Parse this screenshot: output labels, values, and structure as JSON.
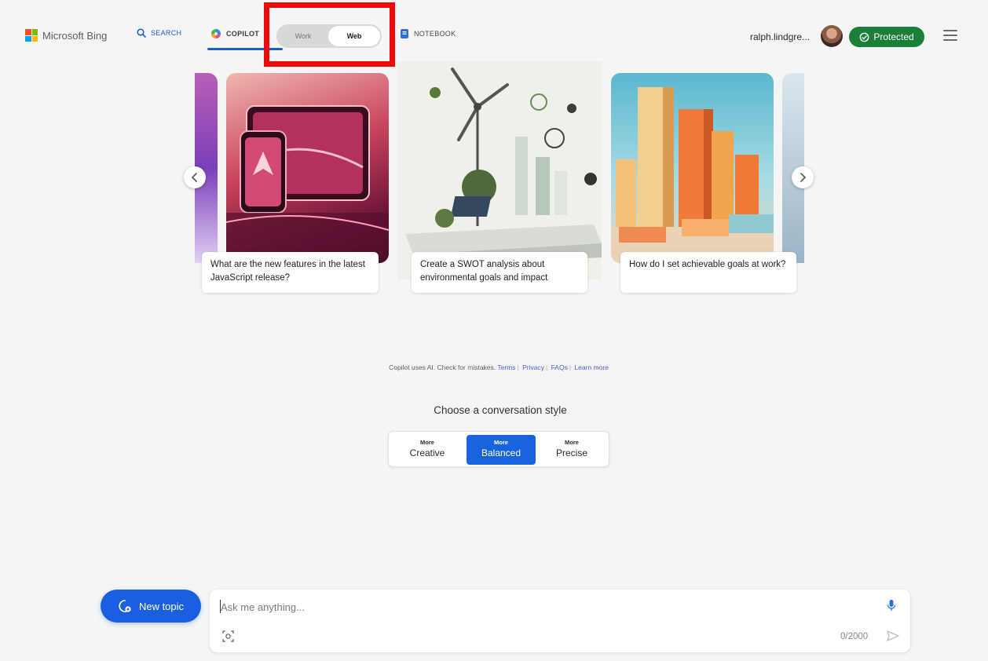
{
  "header": {
    "brand": "Microsoft Bing",
    "nav": {
      "search": "SEARCH",
      "copilot": "COPILOT",
      "notebook": "NOTEBOOK"
    },
    "toggle": {
      "work": "Work",
      "web": "Web",
      "selected": "Web"
    },
    "user_name": "ralph.lindgre...",
    "protected_label": "Protected"
  },
  "carousel": {
    "cards": [
      {
        "caption": "What are the new features in the latest JavaScript release?"
      },
      {
        "caption": "Create a SWOT analysis about environmental goals and impact"
      },
      {
        "caption": "How do I set achievable goals at work?"
      }
    ]
  },
  "disclaimer": {
    "text": "Copilot uses AI. Check for mistakes.",
    "links": [
      "Terms",
      "Privacy",
      "FAQs",
      "Learn more"
    ]
  },
  "conversation_style": {
    "title": "Choose a conversation style",
    "options": [
      {
        "prefix": "More",
        "name": "Creative"
      },
      {
        "prefix": "More",
        "name": "Balanced"
      },
      {
        "prefix": "More",
        "name": "Precise"
      }
    ],
    "selected": "Balanced"
  },
  "composer": {
    "new_topic": "New topic",
    "placeholder": "Ask me anything...",
    "char_count": "0/2000"
  },
  "colors": {
    "accent_blue": "#1a5fe0",
    "protected_green": "#1a7f37",
    "highlight_red": "#ea0a0a"
  },
  "icons": {
    "search": "search-icon",
    "copilot": "copilot-logo-icon",
    "notebook": "notebook-icon",
    "protected": "shield-check-icon",
    "menu": "hamburger-menu-icon",
    "prev": "chevron-left-icon",
    "next": "chevron-right-icon",
    "new_topic": "new-chat-icon",
    "mic": "microphone-icon",
    "visual_search": "image-scan-icon",
    "send": "send-icon"
  }
}
